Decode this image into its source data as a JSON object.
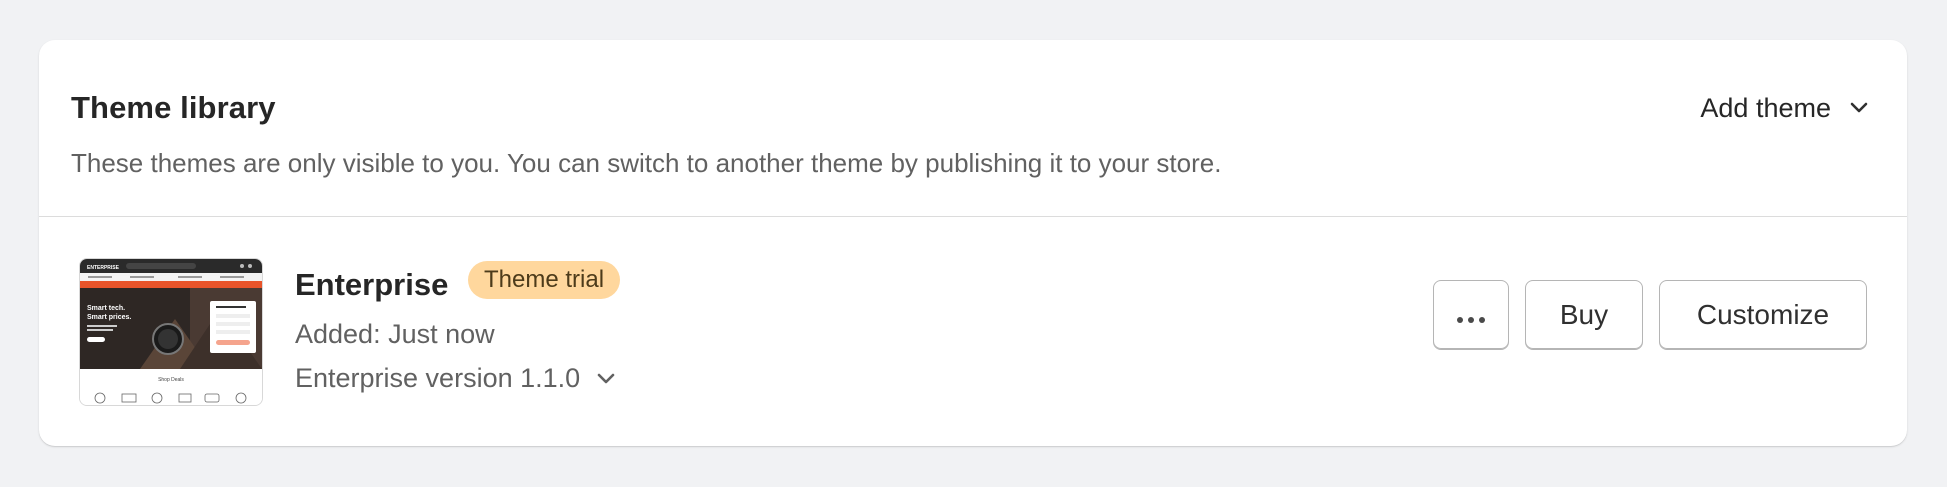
{
  "header": {
    "title": "Theme library",
    "subtitle": "These themes are only visible to you. You can switch to another theme by publishing it to your store.",
    "add_theme_label": "Add theme"
  },
  "theme": {
    "name": "Enterprise",
    "badge": "Theme trial",
    "added": "Added: Just now",
    "version": "Enterprise version 1.1.0",
    "thumbnail": {
      "logo": "ENTERPRISE",
      "headline_1": "Smart tech.",
      "headline_2": "Smart prices.",
      "section_title": "Shop Deals",
      "accent": "#e8542a"
    }
  },
  "actions": {
    "more_label": "•••",
    "buy_label": "Buy",
    "customize_label": "Customize"
  },
  "colors": {
    "background": "#f1f2f4",
    "card": "#ffffff",
    "badge": "#ffd79d",
    "text": "#303030",
    "subdued": "#616161"
  }
}
